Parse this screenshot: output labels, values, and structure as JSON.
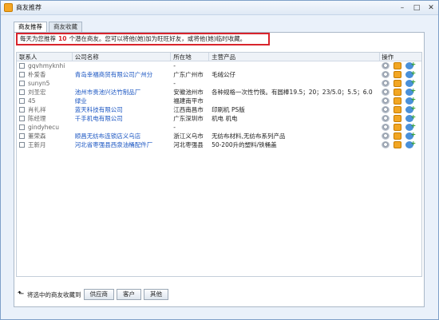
{
  "window": {
    "title": "商友推荐",
    "brand_color": "#f5a623"
  },
  "tabs": [
    {
      "label": "商友推荐",
      "active": true
    },
    {
      "label": "商友收藏",
      "active": false
    }
  ],
  "notice": {
    "prefix": "每天为您推荐",
    "count": "10",
    "suffix": "个潜在商友。您可以将他(她)加为旺旺好友，或将他(她)临时收藏。"
  },
  "table": {
    "headers": [
      "联系人",
      "公司名称",
      "所在地",
      "主营产品",
      "操作"
    ],
    "rows": [
      {
        "contact": "gqvhmyknhi",
        "company": "",
        "location": "-",
        "product": ""
      },
      {
        "contact": "朴爱香",
        "company": "青岛幸福商贸有限公司广州分",
        "location": "广东广州市",
        "product": "毛绒公仔"
      },
      {
        "contact": "sunyn5",
        "company": "",
        "location": "-",
        "product": ""
      },
      {
        "contact": "刘圣宏",
        "company": "池州市贵池兴达竹制品厂",
        "location": "安徽池州市",
        "product": "各种规格一次性竹筷。有圆棒19.5；20；23/5.0；5.5；6.0"
      },
      {
        "contact": "45",
        "company": "绿业",
        "location": "福建南平市",
        "product": ""
      },
      {
        "contact": "肖礼祥",
        "company": "蓝天科技有限公司",
        "location": "江西南昌市",
        "product": "印刷机 PS版"
      },
      {
        "contact": "陈经理",
        "company": "千手机电有限公司",
        "location": "广东深圳市",
        "product": "机电 机电"
      },
      {
        "contact": "gindyhecu",
        "company": "",
        "location": "-",
        "product": ""
      },
      {
        "contact": "董荣森",
        "company": "顺昌无纺布连锁店义乌店",
        "location": "浙江义乌市",
        "product": "无纺布材料,无纺布系列产品"
      },
      {
        "contact": "王新月",
        "company": "河北省枣强县西泉油桶配件厂",
        "location": "河北枣强县",
        "product": "50-200升的塑料/铁桶盖"
      }
    ]
  },
  "bottom": {
    "label": "将选中的商友收藏到",
    "buttons": [
      "供应商",
      "客户",
      "其他"
    ]
  }
}
